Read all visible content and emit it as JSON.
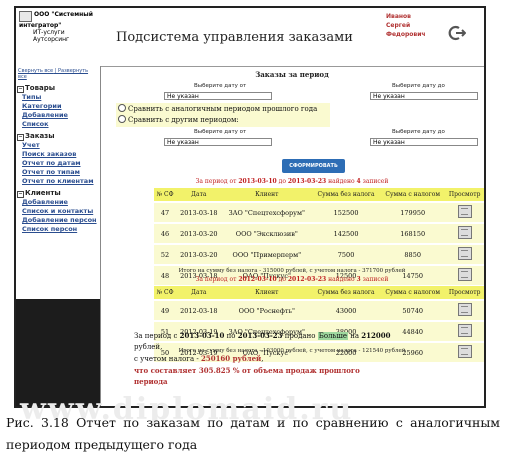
{
  "header": {
    "company_line1": "ООО \"Системный интегратор\"",
    "company_line2": "ИТ-услуги",
    "company_line3": "Аутсорсинг",
    "app_title": "Подсистема управления заказами",
    "user_last": "Иванов",
    "user_first": "Сергей",
    "user_middle": "Федорович"
  },
  "sidebar": {
    "collapse_all": "Свернуть все",
    "separator": " | ",
    "expand_all": "Развернуть все",
    "groups": [
      {
        "title": "Товары",
        "items": [
          "Типы",
          "Категории",
          "Добавление",
          "Список"
        ]
      },
      {
        "title": "Заказы",
        "items": [
          "Учет",
          "Поиск заказов",
          "Отчет по датам",
          "Отчет по типам",
          "Отчет по клиентам"
        ]
      },
      {
        "title": "Клиенты",
        "items": [
          "Добавление",
          "Список и контакты",
          "Добавление персон",
          "Список персон"
        ]
      }
    ]
  },
  "report": {
    "title": "Заказы за период",
    "date_from_label": "Выберите дату от",
    "date_to_label": "Выберите дату до",
    "date_from_value": "Не указан",
    "date_to_value": "Не указан",
    "radio_same_period": "Сравнить с аналогичным периодом прошлого года",
    "radio_other_period": "Сравнить с другим периодом:",
    "date2_from_label": "Выберите дату от",
    "date2_to_label": "Выберите дату до",
    "date2_from_value": "Не указан",
    "date2_to_value": "Не указан",
    "submit_label": "СФОРМИРОВАТЬ ОТЧЕТ"
  },
  "period1": {
    "prefix": "За период от ",
    "from": "2013-03-10",
    "mid": " до ",
    "to": "2013-03-23",
    "suffix": " найдено ",
    "count": "4",
    "suffix2": " записей"
  },
  "columns": [
    "№ СФ",
    "Дата",
    "Клиент",
    "Сумма без налога",
    "Сумма с налогом",
    "Просмотр"
  ],
  "table1": [
    [
      "47",
      "2013-03-18",
      "ЗАО \"Спецтехсфорум\"",
      "152500",
      "179950"
    ],
    [
      "46",
      "2013-03-20",
      "ООО \"Эксклюзив\"",
      "142500",
      "168150"
    ],
    [
      "52",
      "2013-03-20",
      "ООО \"Примерперм\"",
      "7500",
      "8850"
    ],
    [
      "48",
      "2013-03-18",
      "ОАО \"Пускус\"",
      "12500",
      "14750"
    ]
  ],
  "total1": "Итого на сумму без налога - 315000 рублей, с учетом налога - 371700 рублей",
  "period2": {
    "prefix": "За период от ",
    "from": "2012-03-10",
    "mid": " до ",
    "to": "2012-03-23",
    "suffix": " найдено ",
    "count": "3",
    "suffix2": " записей"
  },
  "table2": [
    [
      "49",
      "2012-03-18",
      "ООО \"Роснефть\"",
      "43000",
      "50740"
    ],
    [
      "51",
      "2012-03-19",
      "ЗАО \"Спецтехсфорум\"",
      "38000",
      "44840"
    ],
    [
      "50",
      "2012-03-19",
      "ОАО \"Пускус\"",
      "22000",
      "25960"
    ]
  ],
  "total2": "Итого на сумму без налога - 103000 рублей, с учетом налога - 121540 рублей",
  "summary": {
    "l1_a": "За период с ",
    "l1_from": "2013-03-10",
    "l1_b": " по ",
    "l1_to": "2013-03-23",
    "l1_c": " продано ",
    "l1_hl": "Больше",
    "l1_d": " на ",
    "l1_amt": "212000",
    "l1_e": " рублей,",
    "l2_a": "с учетом налога - ",
    "l2_amt": "250160 рублей",
    "l2_b": ",",
    "l3": "что составляет 305.825 % от объема продаж прошлого периода"
  },
  "watermark": "www.diplomaid.ru",
  "caption": "Рис. 3.18 Отчет по заказам по датам и по сравнению с аналогичным периодом предыдущего года",
  "colors": {
    "header_yellow": "#f2f26a",
    "row_yellow": "#fafad0",
    "button_blue": "#2d6db5",
    "accent_red": "#c02020"
  }
}
